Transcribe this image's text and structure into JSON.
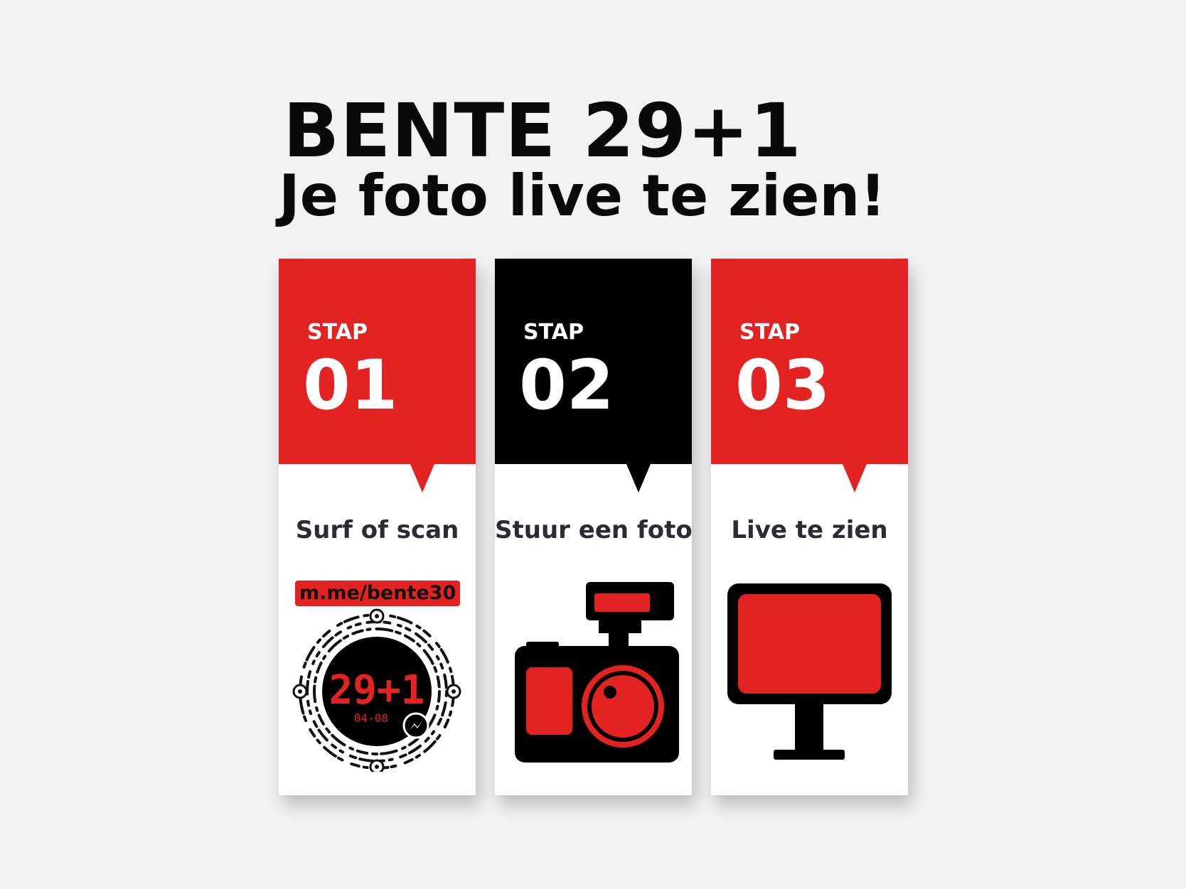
{
  "header": {
    "title": "BENTE 29+1",
    "subtitle": "Je foto live te zien!"
  },
  "colors": {
    "accent": "#e32222",
    "dark": "#000000",
    "background": "#f2f2f2",
    "card": "#ffffff"
  },
  "steps": [
    {
      "stap": "STAP",
      "number": "01",
      "label": "Surf of scan",
      "color": "#e32222",
      "icon": "qr-messenger-code-icon"
    },
    {
      "stap": "STAP",
      "number": "02",
      "label": "Stuur een foto",
      "color": "#000000",
      "icon": "camera-icon"
    },
    {
      "stap": "STAP",
      "number": "03",
      "label": "Live te zien",
      "color": "#e32222",
      "icon": "monitor-icon"
    }
  ],
  "link": "m.me/bente30",
  "code": {
    "display": "29+1",
    "date": "04-08"
  }
}
